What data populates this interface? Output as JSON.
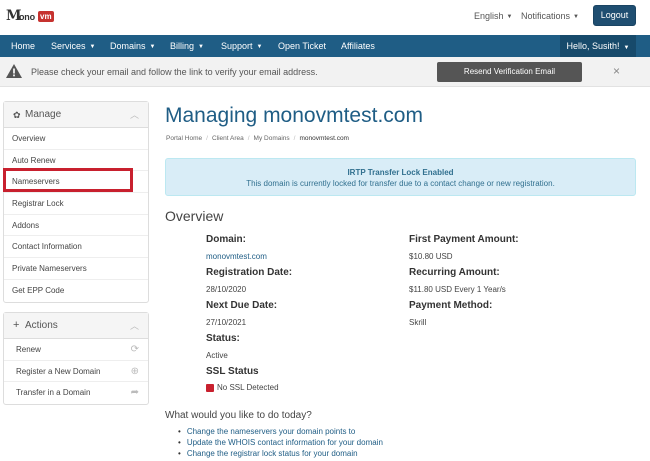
{
  "brand": {
    "logo_letter": "M",
    "logo_rest": "ono",
    "logo_badge": "vm"
  },
  "top": {
    "language": "English",
    "notifications": "Notifications",
    "logout": "Logout"
  },
  "nav": {
    "items": [
      "Home",
      "Services",
      "Domains",
      "Billing",
      "Support",
      "Open Ticket",
      "Affiliates"
    ],
    "user": "Hello, Susith!"
  },
  "alert": {
    "text": "Please check your email and follow the link to verify your email address.",
    "button": "Resend Verification Email",
    "close": "×"
  },
  "manage": {
    "title": "Manage",
    "items": [
      "Overview",
      "Auto Renew",
      "Nameservers",
      "Registrar Lock",
      "Addons",
      "Contact Information",
      "Private Nameservers",
      "Get EPP Code"
    ]
  },
  "actions": {
    "title": "Actions",
    "items": [
      "Renew",
      "Register a New Domain",
      "Transfer in a Domain"
    ]
  },
  "page": {
    "title": "Managing monovmtest.com",
    "breadcrumb": [
      "Portal Home",
      "Client Area",
      "My Domains",
      "monovmtest.com"
    ],
    "info_title": "IRTP Transfer Lock Enabled",
    "info_text": "This domain is currently locked for transfer due to a contact change or new registration.",
    "overview_title": "Overview"
  },
  "overview": {
    "domain_label": "Domain:",
    "domain_value": "monovmtest.com",
    "reg_label": "Registration Date:",
    "reg_value": "28/10/2020",
    "due_label": "Next Due Date:",
    "due_value": "27/10/2021",
    "status_label": "Status:",
    "status_value": "Active",
    "ssl_label": "SSL Status",
    "ssl_value": "No SSL Detected",
    "first_pay_label": "First Payment Amount:",
    "first_pay_value": "$10.80 USD",
    "recurring_label": "Recurring Amount:",
    "recurring_value": "$11.80 USD Every 1 Year/s",
    "method_label": "Payment Method:",
    "method_value": "Skrill"
  },
  "todo": {
    "question": "What would you like to do today?",
    "links": [
      "Change the nameservers your domain points to",
      "Update the WHOIS contact information for your domain",
      "Change the registrar lock status for your domain"
    ]
  },
  "colors": {
    "primary": "#1f5d85",
    "highlight": "#c8202e",
    "info_bg": "#d9edf7"
  }
}
